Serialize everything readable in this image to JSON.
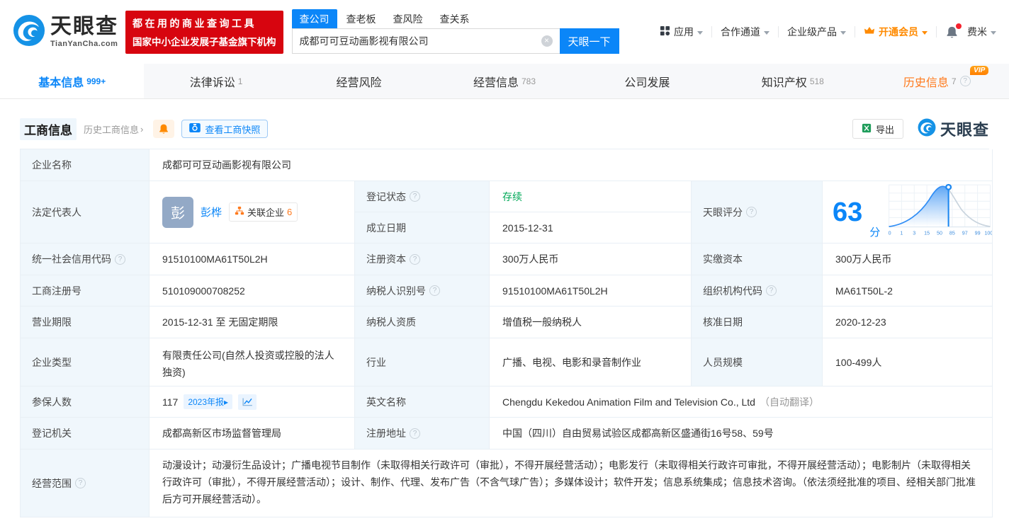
{
  "header": {
    "logo": {
      "title": "天眼查",
      "domain": "TianYanCha.com"
    },
    "slogan": {
      "line1": "都在用的商业查询工具",
      "line2": "国家中小企业发展子基金旗下机构"
    },
    "search": {
      "tabs": [
        {
          "label": "查公司"
        },
        {
          "label": "查老板"
        },
        {
          "label": "查风险"
        },
        {
          "label": "查关系"
        }
      ],
      "value": "成都可可豆动画影视有限公司",
      "button": "天眼一下"
    },
    "menu": {
      "apps": "应用",
      "partner": "合作通道",
      "enterprise": "企业级产品",
      "vip": "开通会员",
      "user": "费米"
    }
  },
  "nav": {
    "tabs": [
      {
        "label": "基本信息",
        "count": "999+"
      },
      {
        "label": "法律诉讼",
        "count": "1"
      },
      {
        "label": "经营风险",
        "count": ""
      },
      {
        "label": "经营信息",
        "count": "783"
      },
      {
        "label": "公司发展",
        "count": ""
      },
      {
        "label": "知识产权",
        "count": "518"
      },
      {
        "label": "历史信息",
        "count": "7"
      }
    ],
    "vip_label": "VIP"
  },
  "section": {
    "title": "工商信息",
    "history_link": "历史工商信息",
    "snapshot_button": "查看工商快照",
    "export_button": "导出",
    "watermark": "天眼查"
  },
  "table": {
    "company_name": {
      "label": "企业名称",
      "value": "成都可可豆动画影视有限公司"
    },
    "legal_rep": {
      "label": "法定代表人",
      "avatar": "彭",
      "name": "彭桦",
      "related_label": "关联企业",
      "related_count": "6"
    },
    "reg_status": {
      "label": "登记状态",
      "value": "存续"
    },
    "establish_date": {
      "label": "成立日期",
      "value": "2015-12-31"
    },
    "tyc_score": {
      "label": "天眼评分",
      "value": "63",
      "unit": "分"
    },
    "credit_code": {
      "label": "统一社会信用代码",
      "value": "91510100MA61T50L2H"
    },
    "reg_capital": {
      "label": "注册资本",
      "value": "300万人民币"
    },
    "paid_capital": {
      "label": "实缴资本",
      "value": "300万人民币"
    },
    "reg_number": {
      "label": "工商注册号",
      "value": "510109000708252"
    },
    "taxpayer_id": {
      "label": "纳税人识别号",
      "value": "91510100MA61T50L2H"
    },
    "org_code": {
      "label": "组织机构代码",
      "value": "MA61T50L-2"
    },
    "business_term": {
      "label": "营业期限",
      "value": "2015-12-31 至 无固定期限"
    },
    "taxpayer_quality": {
      "label": "纳税人资质",
      "value": "增值税一般纳税人"
    },
    "approval_date": {
      "label": "核准日期",
      "value": "2020-12-23"
    },
    "company_type": {
      "label": "企业类型",
      "value": "有限责任公司(自然人投资或控股的法人独资)"
    },
    "industry": {
      "label": "行业",
      "value": "广播、电视、电影和录音制作业"
    },
    "staff_size": {
      "label": "人员规模",
      "value": "100-499人"
    },
    "insured_count": {
      "label": "参保人数",
      "value": "117",
      "report_badge": "2023年报"
    },
    "english_name": {
      "label": "英文名称",
      "value": "Chengdu Kekedou Animation Film and Television Co., Ltd",
      "note": "（自动翻译）"
    },
    "reg_authority": {
      "label": "登记机关",
      "value": "成都高新区市场监督管理局"
    },
    "reg_address": {
      "label": "注册地址",
      "value": "中国（四川）自由贸易试验区成都高新区盛通街16号58、59号"
    },
    "business_scope": {
      "label": "经营范围",
      "value": "动漫设计；动漫衍生品设计；广播电视节目制作（未取得相关行政许可（审批），不得开展经营活动）；电影发行（未取得相关行政许可审批，不得开展经营活动）；电影制片（未取得相关行政许可（审批），不得开展经营活动）；设计、制作、代理、发布广告（不含气球广告）；多媒体设计；软件开发；信息系统集成；信息技术咨询。（依法须经批准的项目、经相关部门批准后方可开展经营活动）。"
    }
  },
  "chart_data": {
    "type": "area",
    "title": "天眼评分",
    "score": 63,
    "score_display": "63分",
    "x_ticks": [
      "0",
      "1",
      "3",
      "15",
      "50",
      "85",
      "97",
      "99",
      "100"
    ],
    "marker_x": 63,
    "legend_position": "none",
    "grid": true,
    "note": "bell-curve score distribution, area filled up to score marker"
  },
  "icons": {
    "question": "?",
    "clear": "×",
    "chevron": "›",
    "report_arrow": "▸"
  },
  "colors": {
    "accent": "#0b86f8",
    "brand_red": "#d7050f",
    "orange": "#ff7a1d",
    "green": "#00a857",
    "label_bg": "#f0f7fc",
    "border": "#e8eff5"
  }
}
